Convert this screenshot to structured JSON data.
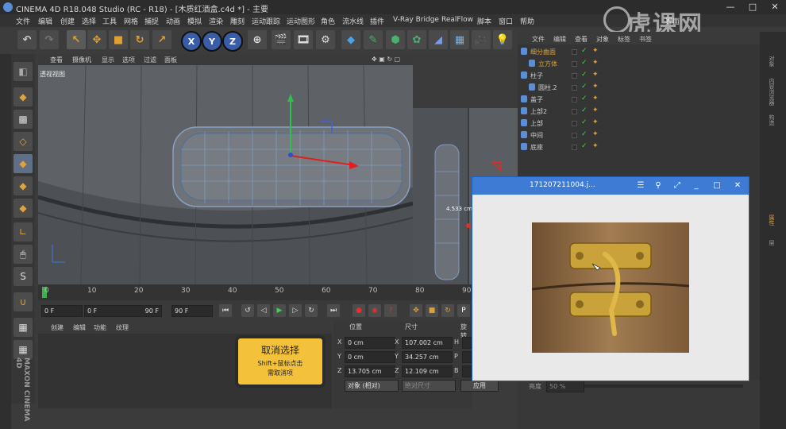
{
  "window": {
    "title": "CINEMA 4D R18.048 Studio (RC - R18) - [木质红酒盒.c4d *] - 主要",
    "controls": [
      "—",
      "□",
      "✕"
    ]
  },
  "menubar": [
    "文件",
    "编辑",
    "创建",
    "选择",
    "工具",
    "网格",
    "捕捉",
    "动画",
    "模拟",
    "渲染",
    "雕刻",
    "运动跟踪",
    "运动图形",
    "角色",
    "流水线",
    "插件",
    "V-Ray Bridge",
    "RealFlow",
    "脚本",
    "窗口",
    "帮助"
  ],
  "layout_label": "界面",
  "toolbar": {
    "axis_x": "X",
    "axis_y": "Y",
    "axis_z": "Z"
  },
  "viewport": {
    "menu": [
      "查看",
      "摄像机",
      "显示",
      "选项",
      "过滤",
      "面板"
    ],
    "label": "透视视图",
    "measure": "4.533 cm"
  },
  "timeline": {
    "ticks": [
      "0",
      "10",
      "20",
      "30",
      "40",
      "50",
      "60",
      "70",
      "80",
      "90"
    ],
    "start_field": "0 F",
    "current_field": "0 F",
    "end_field_inner": "90 F",
    "end_field": "90 F"
  },
  "material_manager": {
    "menu": [
      "创建",
      "编辑",
      "功能",
      "纹理"
    ]
  },
  "coord_manager": {
    "headers": [
      "位置",
      "尺寸",
      "旋转"
    ],
    "rows": [
      {
        "axis": "X",
        "pos": "0 cm",
        "size": "107.002 cm",
        "rot_axis": "H"
      },
      {
        "axis": "Y",
        "pos": "0 cm",
        "size": "34.257 cm",
        "rot_axis": "P"
      },
      {
        "axis": "Z",
        "pos": "13.705 cm",
        "size": "12.109 cm",
        "rot_axis": "B"
      }
    ],
    "mode_select": "对象 (相对)",
    "size_select": "绝对尺寸",
    "apply": "应用"
  },
  "tooltip_card": {
    "line1": "取消选择",
    "line2": "Shift+鼠标点击",
    "line3": "需取消项"
  },
  "object_manager": {
    "tabs": [
      "文件",
      "编辑",
      "查看",
      "对象",
      "标签",
      "书签"
    ],
    "items": [
      {
        "label": "细分曲面",
        "color": "#e0a030"
      },
      {
        "label": "立方体",
        "color": "#e0a030"
      },
      {
        "label": "柱子",
        "color": "#cfcfcf"
      },
      {
        "label": "圆柱.2",
        "color": "#cfcfcf"
      },
      {
        "label": "盖子",
        "color": "#cfcfcf"
      },
      {
        "label": "上部2",
        "color": "#cfcfcf"
      },
      {
        "label": "上部",
        "color": "#cfcfcf"
      },
      {
        "label": "中间",
        "color": "#cfcfcf"
      },
      {
        "label": "底座",
        "color": "#cfcfcf"
      }
    ],
    "attr_label": "亮度",
    "attr_value": "50 %"
  },
  "right_strip": [
    "对象",
    "内容浏览器",
    "构造",
    "属性",
    "层"
  ],
  "image_viewer": {
    "title": "171207211004.j..."
  },
  "watermark": "虎课网",
  "maxon": "MAXON CINEMA 4D"
}
